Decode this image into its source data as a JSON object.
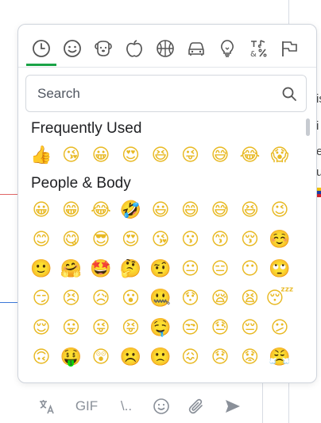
{
  "background": {
    "edge_letters": [
      "is",
      "i",
      "e",
      "u"
    ]
  },
  "picker": {
    "tabs": [
      {
        "name": "recent",
        "icon": "clock-icon",
        "active": true
      },
      {
        "name": "smileys",
        "icon": "smiley-icon"
      },
      {
        "name": "animals",
        "icon": "dog-icon"
      },
      {
        "name": "food",
        "icon": "apple-icon"
      },
      {
        "name": "activity",
        "icon": "ball-icon"
      },
      {
        "name": "travel",
        "icon": "car-icon"
      },
      {
        "name": "objects",
        "icon": "lightbulb-icon"
      },
      {
        "name": "symbols",
        "icon": "symbols-icon"
      },
      {
        "name": "flags",
        "icon": "flag-icon"
      }
    ],
    "accent_color": "#1aa346",
    "search": {
      "placeholder": "Search"
    },
    "sections": [
      {
        "title": "Frequently Used",
        "rows": [
          [
            "👍",
            "😘",
            "😀",
            "😍",
            "😆",
            "😜",
            "😅",
            "😂",
            "😱"
          ]
        ]
      },
      {
        "title": "People & Body",
        "rows": [
          [
            "😀",
            "😁",
            "😂",
            "🤣",
            "😃",
            "😄",
            "😅",
            "😆",
            "😉"
          ],
          [
            "😊",
            "😋",
            "😎",
            "😍",
            "😘",
            "😗",
            "😙",
            "😚",
            "☺️"
          ],
          [
            "🙂",
            "🤗",
            "🤩",
            "🤔",
            "🤨",
            "😐",
            "😑",
            "😶",
            "🙄"
          ],
          [
            "😏",
            "😣",
            "😥",
            "😮",
            "🤐",
            "😯",
            "😪",
            "😫",
            "😴"
          ],
          [
            "😌",
            "😛",
            "😜",
            "😝",
            "🤤",
            "😒",
            "😓",
            "😔",
            "😕"
          ],
          [
            "🙃",
            "🤑",
            "😲",
            "☹️",
            "🙁",
            "😖",
            "😞",
            "😟",
            "😤"
          ]
        ]
      }
    ]
  },
  "composer": {
    "gif_label": "GIF",
    "code_label": "\\..",
    "tools": [
      "translate-icon",
      "gif-button",
      "code-button",
      "emoji-icon",
      "attach-icon",
      "send-icon"
    ]
  }
}
